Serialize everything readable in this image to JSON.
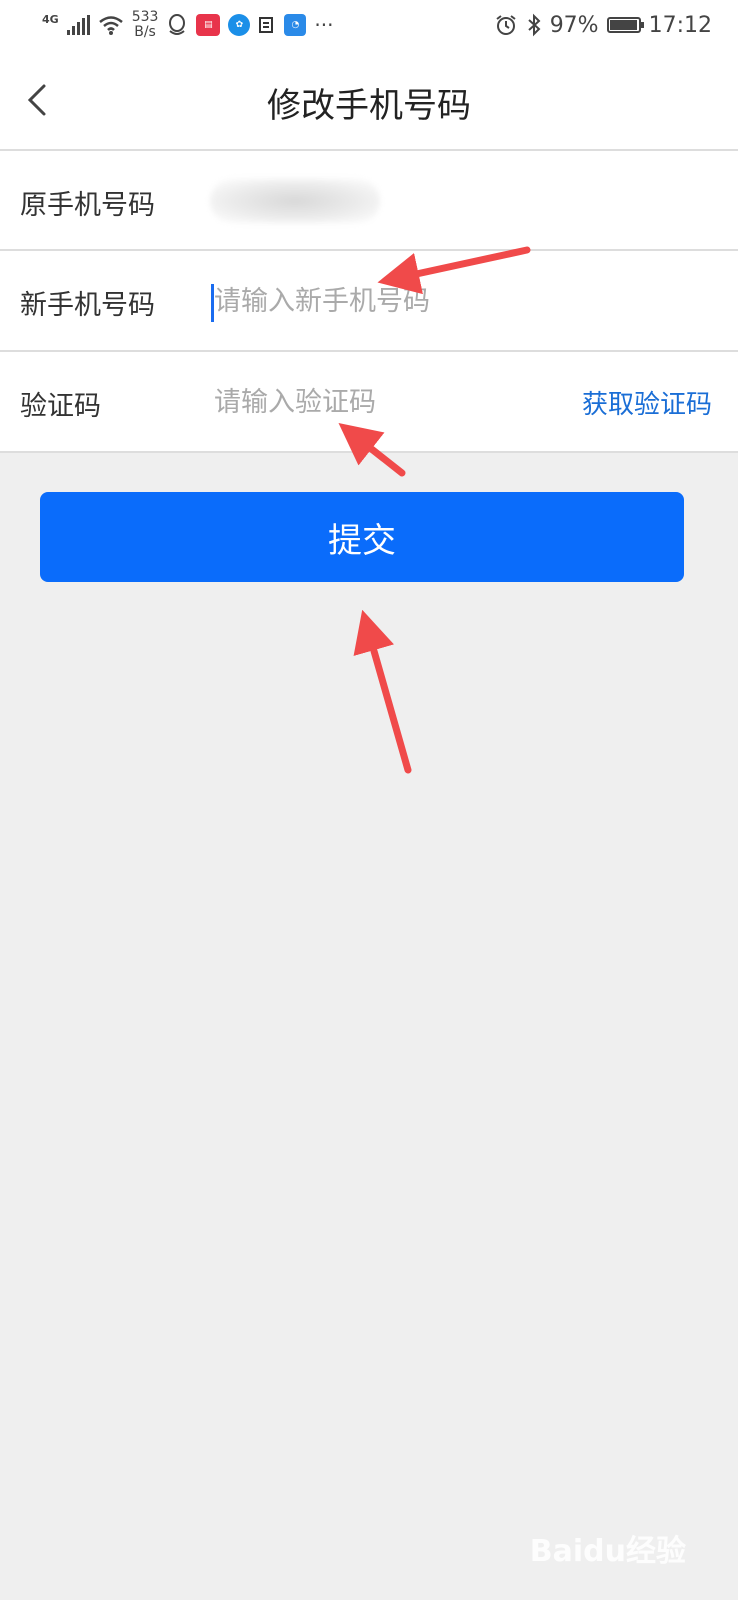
{
  "status_bar": {
    "network": "4G",
    "speed_value": "533",
    "speed_unit": "B/s",
    "battery_percent": "97%",
    "battery_level": 0.97,
    "time": "17:12",
    "more_icon": "···"
  },
  "header": {
    "title": "修改手机号码"
  },
  "form": {
    "old_phone_label": "原手机号码",
    "new_phone_label": "新手机号码",
    "new_phone_placeholder": "请输入新手机号码",
    "code_label": "验证码",
    "code_placeholder": "请输入验证码",
    "get_code_label": "获取验证码"
  },
  "submit_label": "提交",
  "watermark": "Baidu经验",
  "colors": {
    "primary": "#0a6cfb",
    "link": "#1a6ed6",
    "annotation_arrow": "#f04a4a",
    "background": "#efefef"
  }
}
